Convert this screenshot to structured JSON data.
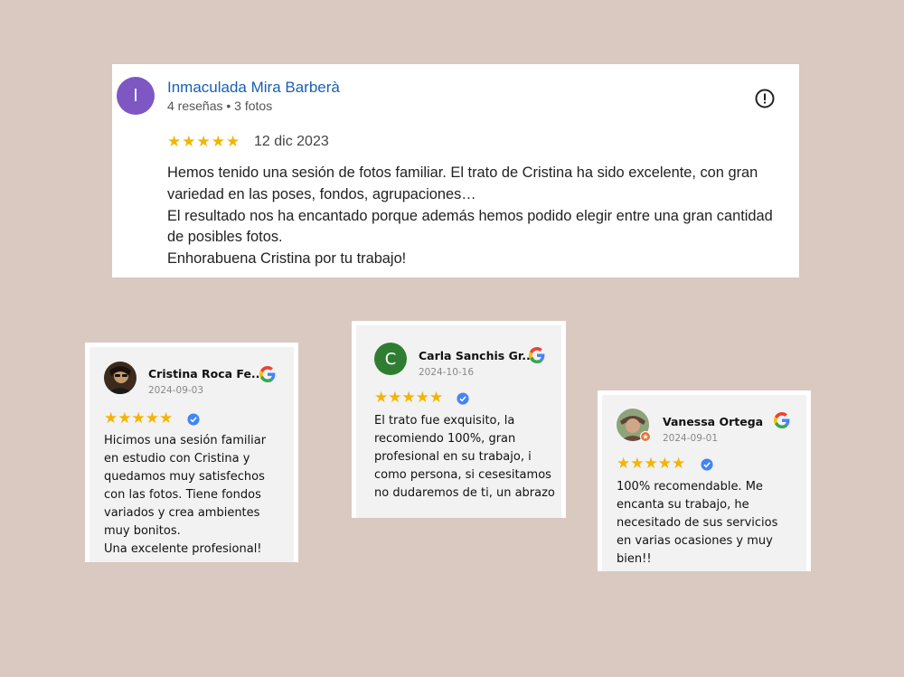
{
  "main_review": {
    "avatar_letter": "I",
    "name": "Inmaculada Mira Barberà",
    "meta": "4 reseñas • 3 fotos",
    "stars": "★★★★★",
    "rating": 5,
    "date": "12 dic 2023",
    "lines": [
      "Hemos tenido una sesión de fotos familiar. El trato de Cristina ha sido excelente, con gran variedad en las poses, fondos, agrupaciones…",
      "El resultado nos ha encantado porque además hemos podido elegir entre una gran cantidad de posibles fotos.",
      "Enhorabuena Cristina por tu trabajo!"
    ],
    "colors": {
      "avatar": "#7e57c2",
      "name": "#1a5fb4",
      "stars": "#f4b400"
    }
  },
  "reviews": [
    {
      "name": "Cristina Roca Fe...",
      "date": "2024-09-03",
      "stars": "★★★★★",
      "rating": 5,
      "lines": [
        "Hicimos una sesión familiar en estudio con Cristina y quedamos muy satisfechos con las fotos. Tiene fondos variados y crea ambientes muy bonitos.",
        "Una excelente profesional!"
      ]
    },
    {
      "avatar_letter": "C",
      "name": "Carla Sanchis Gr...",
      "date": "2024-10-16",
      "stars": "★★★★★",
      "rating": 5,
      "lines": [
        "El trato fue exquisito, la recomiendo 100%, gran profesional en su trabajo, i como persona, si cesesitamos no dudaremos de ti, un abrazo"
      ]
    },
    {
      "name": "Vanessa Ortega",
      "date": "2024-09-01",
      "stars": "★★★★★",
      "rating": 5,
      "lines": [
        "100% recomendable. Me encanta su trabajo, he necesitado de sus servicios en varias ocasiones y muy bien!!"
      ]
    }
  ],
  "icons": {
    "flag": "report-flag-icon",
    "google": "google-g-icon",
    "verified": "verified-check-icon"
  }
}
